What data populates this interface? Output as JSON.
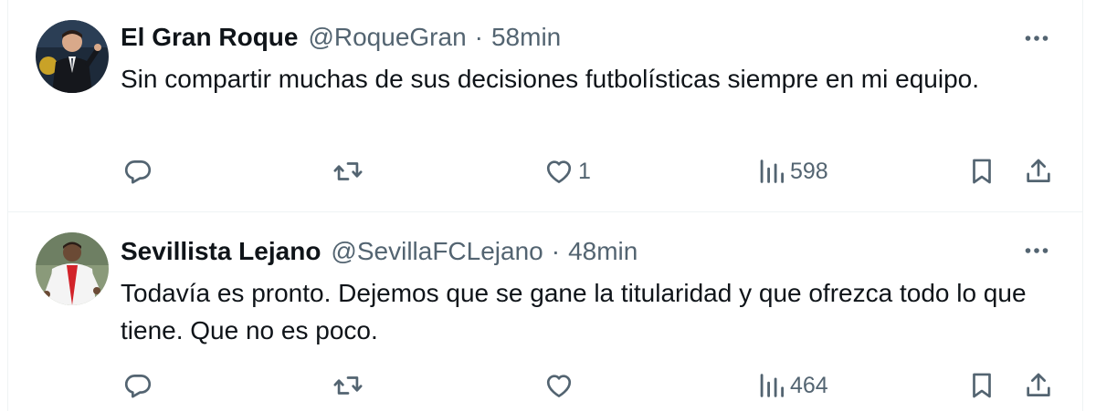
{
  "tweets": [
    {
      "name": "El Gran Roque",
      "handle": "@RoqueGran",
      "separator": "·",
      "time": "58min",
      "text": "Sin compartir muchas de sus decisiones futbolísticas siempre en mi equipo.",
      "likes": "1",
      "views": "598",
      "avatar_icon": "avatar-man-in-suit"
    },
    {
      "name": "Sevillista Lejano",
      "handle": "@SevillaFCLejano",
      "separator": "·",
      "time": "48min",
      "text": "Todavía es pronto. Dejemos que se gane la titularidad y que ofrezca todo lo que tiene. Que no es poco.",
      "likes": "",
      "views": "464",
      "avatar_icon": "avatar-football-player"
    }
  ],
  "icons": {
    "reply": "reply-icon",
    "retweet": "retweet-icon",
    "like": "heart-icon",
    "views": "views-chart-icon",
    "bookmark": "bookmark-icon",
    "share": "share-icon",
    "more": "more-dots-icon"
  },
  "colors": {
    "text_primary": "#0f1419",
    "text_secondary": "#536471",
    "divider": "#eff3f4"
  }
}
